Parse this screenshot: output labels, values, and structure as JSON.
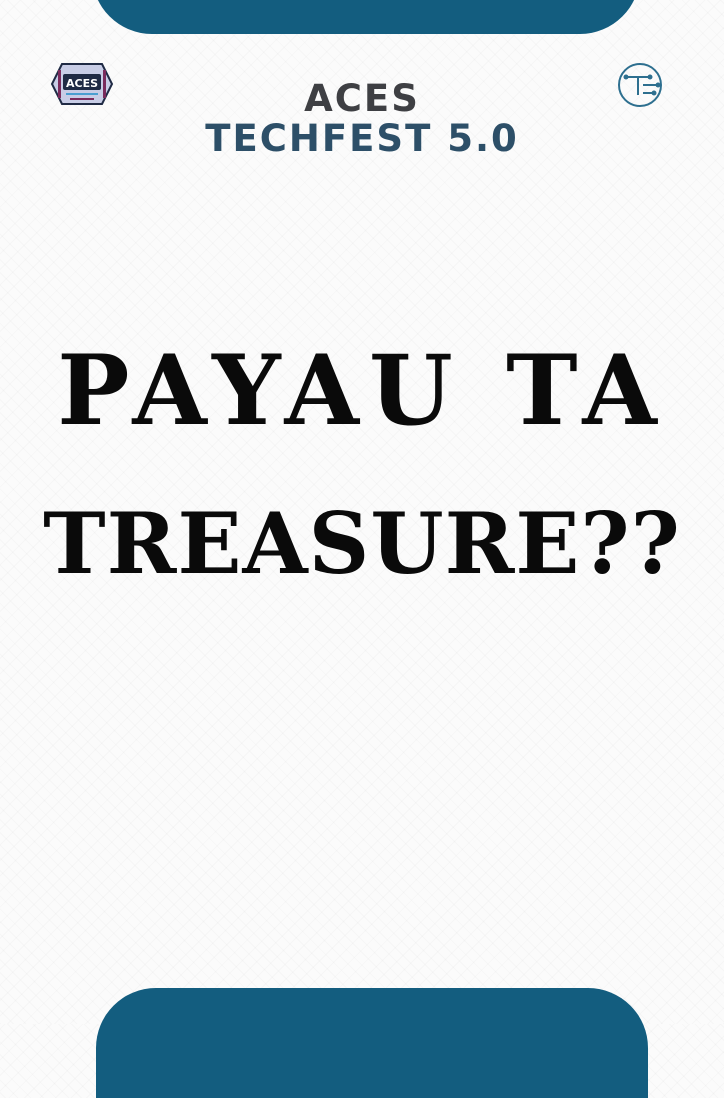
{
  "header": {
    "org_name": "ACES",
    "event_name": "TECHFEST 5.0",
    "left_logo_text": "ACES",
    "left_logo_icon": "aces-logo-icon",
    "right_logo_icon": "techfest-circuit-logo-icon"
  },
  "main": {
    "title_line_1": "PAYAU TA",
    "title_line_2": "TREASURE??"
  },
  "colors": {
    "accent": "#135d7f",
    "org_text": "#3e3f43",
    "event_text": "#2d4f68",
    "title_text": "#0a0a0a",
    "background": "#fbfbfb"
  }
}
